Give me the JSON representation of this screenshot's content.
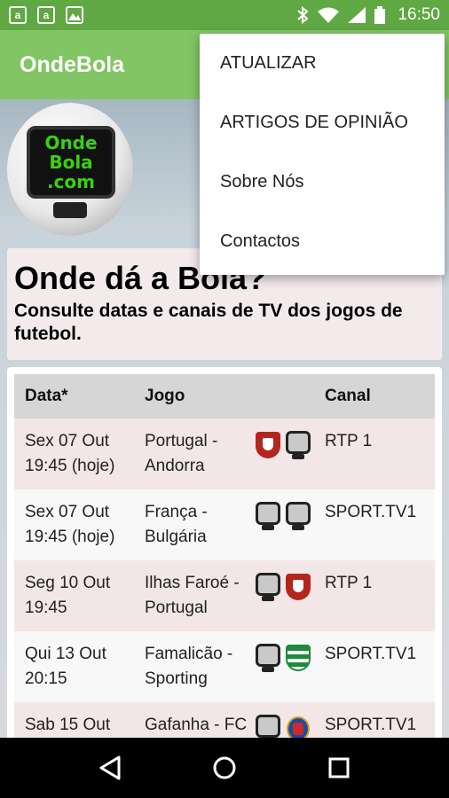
{
  "status_bar": {
    "time": "16:50",
    "left_icons": [
      "amazon-icon",
      "amazon-icon",
      "image-icon"
    ],
    "right_icons": [
      "bluetooth-icon",
      "wifi-icon",
      "signal-icon",
      "battery-icon"
    ],
    "amazon_glyph": "a"
  },
  "app": {
    "title": "OndeBola",
    "accent": "#82c564",
    "status_color": "#5fa844"
  },
  "logo": {
    "lines": [
      "Onde",
      "Bola",
      ".com"
    ]
  },
  "hero": {
    "title": "Onde dá a Bola?",
    "subtitle": "Consulte datas e canais de TV dos jogos de futebol."
  },
  "table": {
    "headers": {
      "date": "Data*",
      "game": "Jogo",
      "channel": "Canal"
    },
    "rows": [
      {
        "date_line1": "Sex 07 Out",
        "date_line2": "19:45 (hoje)",
        "game_line1": "Portugal -",
        "game_line2": "Andorra",
        "icons": [
          "portugal-crest-icon",
          "tv-icon"
        ],
        "channel": "RTP 1"
      },
      {
        "date_line1": "Sex 07 Out",
        "date_line2": "19:45 (hoje)",
        "game_line1": "França -",
        "game_line2": "Bulgária",
        "icons": [
          "tv-icon",
          "tv-icon"
        ],
        "channel": "SPORT.TV1"
      },
      {
        "date_line1": "Seg 10 Out",
        "date_line2": "19:45",
        "game_line1": "Ilhas Faroé -",
        "game_line2": "Portugal",
        "icons": [
          "tv-icon",
          "portugal-crest-icon"
        ],
        "channel": "RTP 1"
      },
      {
        "date_line1": "Qui 13 Out",
        "date_line2": "20:15",
        "game_line1": "Famalicão -",
        "game_line2": "Sporting",
        "icons": [
          "tv-icon",
          "sporting-crest-icon"
        ],
        "channel": "SPORT.TV1"
      },
      {
        "date_line1": "Sab 15 Out",
        "date_line2": "",
        "game_line1": "Gafanha - FC",
        "game_line2": "",
        "icons": [
          "tv-icon",
          "fcporto-crest-icon"
        ],
        "channel": "SPORT.TV1"
      }
    ]
  },
  "menu": {
    "items": [
      "ATUALIZAR",
      "ARTIGOS DE OPINIÃO",
      "Sobre Nós",
      "Contactos"
    ]
  },
  "nav": {
    "buttons": [
      "back-icon",
      "home-icon",
      "recents-icon"
    ]
  }
}
